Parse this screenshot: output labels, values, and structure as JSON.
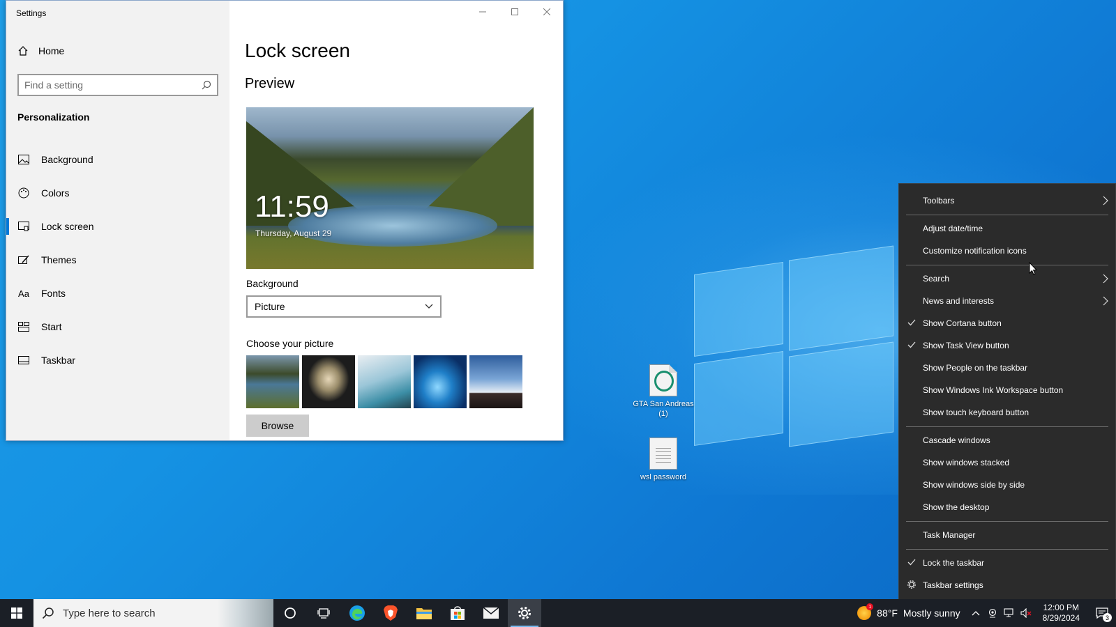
{
  "desktop": {
    "icons": [
      {
        "label": "GTA San Andreas (1)"
      },
      {
        "label": "wsl password"
      }
    ]
  },
  "settings": {
    "window_title": "Settings",
    "home_label": "Home",
    "search_placeholder": "Find a setting",
    "section_title": "Personalization",
    "nav": [
      {
        "label": "Background",
        "icon": "image-icon"
      },
      {
        "label": "Colors",
        "icon": "palette-icon"
      },
      {
        "label": "Lock screen",
        "icon": "lock-screen-icon",
        "active": true
      },
      {
        "label": "Themes",
        "icon": "themes-icon"
      },
      {
        "label": "Fonts",
        "icon": "fonts-icon"
      },
      {
        "label": "Start",
        "icon": "start-icon"
      },
      {
        "label": "Taskbar",
        "icon": "taskbar-icon"
      }
    ],
    "page_title": "Lock screen",
    "preview_heading": "Preview",
    "preview_time": "11:59",
    "preview_date": "Thursday, August 29",
    "background_label": "Background",
    "background_value": "Picture",
    "choose_picture_label": "Choose your picture",
    "browse_label": "Browse",
    "accent": "#0078d7"
  },
  "context_menu": {
    "items": [
      {
        "label": "Toolbars",
        "submenu": true
      },
      {
        "label": "Adjust date/time"
      },
      {
        "label": "Customize notification icons"
      },
      {
        "label": "Search",
        "submenu": true
      },
      {
        "label": "News and interests",
        "submenu": true
      },
      {
        "label": "Show Cortana button",
        "checked": true
      },
      {
        "label": "Show Task View button",
        "checked": true
      },
      {
        "label": "Show People on the taskbar"
      },
      {
        "label": "Show Windows Ink Workspace button"
      },
      {
        "label": "Show touch keyboard button"
      },
      {
        "label": "Cascade windows"
      },
      {
        "label": "Show windows stacked"
      },
      {
        "label": "Show windows side by side"
      },
      {
        "label": "Show the desktop"
      },
      {
        "label": "Task Manager"
      },
      {
        "label": "Lock the taskbar",
        "checked": true
      },
      {
        "label": "Taskbar settings",
        "icon": "gear-icon"
      }
    ]
  },
  "taskbar": {
    "search_placeholder": "Type here to search",
    "weather_temp": "88°F",
    "weather_text": "Mostly sunny",
    "weather_badge": "1",
    "clock_time": "12:00 PM",
    "clock_date": "8/29/2024",
    "notification_count": "3"
  }
}
